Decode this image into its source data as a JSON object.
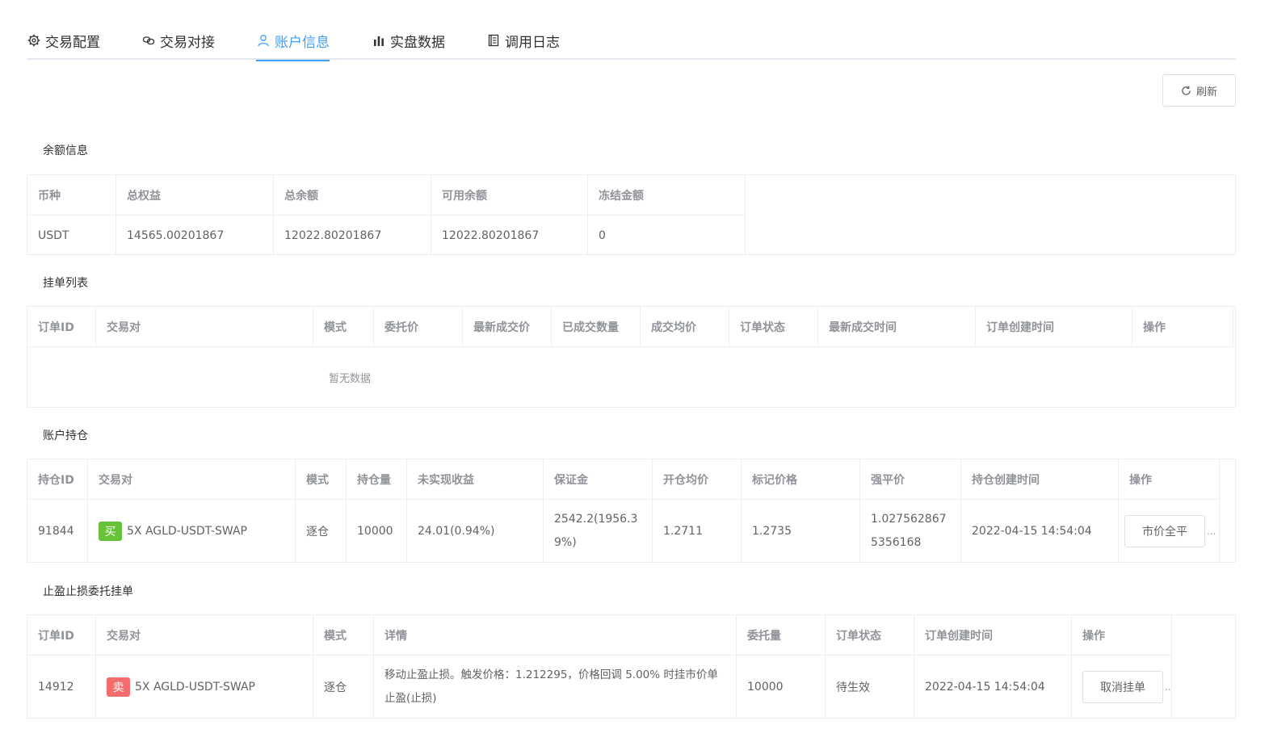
{
  "tabs": [
    {
      "label": "交易配置",
      "icon": "gear-icon"
    },
    {
      "label": "交易对接",
      "icon": "link-icon"
    },
    {
      "label": "账户信息",
      "icon": "user-icon"
    },
    {
      "label": "实盘数据",
      "icon": "bar-chart-icon"
    },
    {
      "label": "调用日志",
      "icon": "document-icon"
    }
  ],
  "active_tab": "账户信息",
  "accent_color": "#409eff",
  "refresh_label": "刷新",
  "balance": {
    "title": "余额信息",
    "headers": [
      "币种",
      "总权益",
      "总余额",
      "可用余额",
      "冻结金额"
    ],
    "rows": [
      [
        "USDT",
        "14565.00201867",
        "12022.80201867",
        "12022.80201867",
        "0"
      ]
    ]
  },
  "pending_orders": {
    "title": "挂单列表",
    "headers": [
      "订单ID",
      "交易对",
      "模式",
      "委托价",
      "最新成交价",
      "已成交数量",
      "成交均价",
      "订单状态",
      "最新成交时间",
      "订单创建时间",
      "操作"
    ],
    "empty_text": "暂无数据"
  },
  "positions": {
    "title": "账户持仓",
    "headers": [
      "持仓ID",
      "交易对",
      "模式",
      "持仓量",
      "未实现收益",
      "保证金",
      "开仓均价",
      "标记价格",
      "强平价",
      "持仓创建时间",
      "操作"
    ],
    "rows": [
      {
        "id": "91844",
        "side_tag": "买",
        "pair": "5X AGLD-USDT-SWAP",
        "mode": "逐仓",
        "qty": "10000",
        "pnl": "24.01(0.94%)",
        "margin": "2542.2(1956.39%)",
        "open_avg": "1.2711",
        "mark_price": "1.2735",
        "liq_price": "1.0275628675356168",
        "created": "2022-04-15 14:54:04",
        "action": "市价全平",
        "overflow": "..."
      }
    ]
  },
  "tpsl_orders": {
    "title": "止盈止损委托挂单",
    "headers": [
      "订单ID",
      "交易对",
      "模式",
      "详情",
      "委托量",
      "订单状态",
      "订单创建时间",
      "操作"
    ],
    "rows": [
      {
        "id": "14912",
        "side_tag": "卖",
        "pair": "5X AGLD-USDT-SWAP",
        "mode": "逐仓",
        "detail": "移动止盈止损。触发价格：1.212295，价格回调 5.00% 时挂市价单止盈(止损)",
        "qty": "10000",
        "status": "待生效",
        "created": "2022-04-15 14:54:04",
        "action": "取消挂单",
        "overflow": ".."
      }
    ]
  }
}
